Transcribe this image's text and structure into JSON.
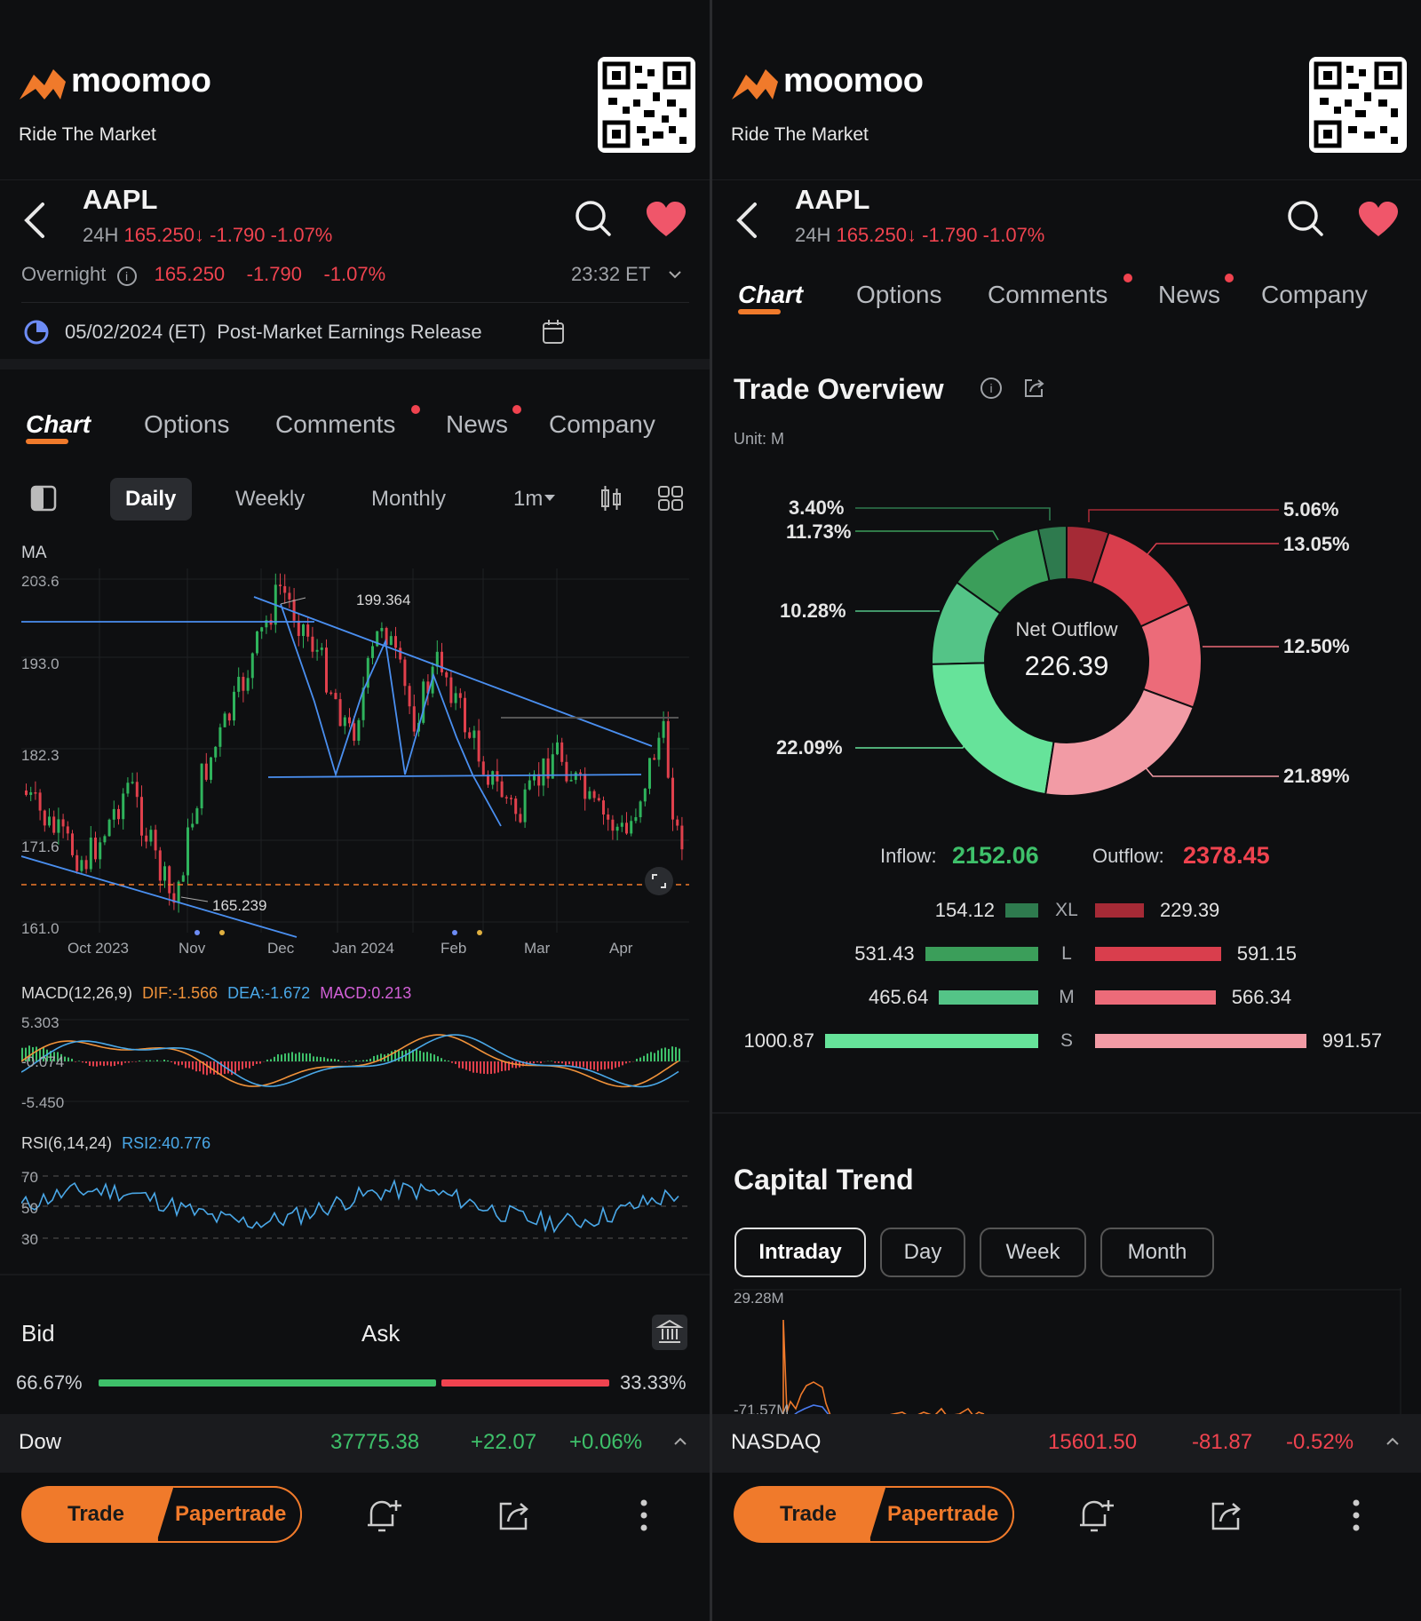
{
  "brand": {
    "name": "moomoo",
    "tagline": "Ride The Market"
  },
  "stock": {
    "symbol": "AAPL",
    "session": "24H",
    "price": "165.250",
    "change": "-1.790",
    "change_pct": "-1.07%",
    "overnight_label": "Overnight",
    "overnight_price": "165.250",
    "overnight_change": "-1.790",
    "overnight_pct": "-1.07%",
    "time": "23:32 ET",
    "earnings": "05/02/2024 (ET)  Post-Market Earnings Release"
  },
  "tabs": [
    "Chart",
    "Options",
    "Comments",
    "News",
    "Company"
  ],
  "period_tabs": [
    "Daily",
    "Weekly",
    "Monthly",
    "1m"
  ],
  "ma_label": "MA",
  "price_axis": [
    "203.6",
    "193.0",
    "182.3",
    "171.6",
    "161.0"
  ],
  "date_axis": [
    "Oct 2023",
    "Nov",
    "Dec",
    "Jan 2024",
    "Feb",
    "Mar",
    "Apr"
  ],
  "annotations": {
    "high": "199.364",
    "low": "165.239"
  },
  "macd": {
    "title": "MACD(12,26,9)",
    "dif": "DIF:-1.566",
    "dea": "DEA:-1.672",
    "macd": "MACD:0.213",
    "axis": [
      "5.303",
      "-0.074",
      "-5.450"
    ]
  },
  "rsi": {
    "title": "RSI(6,14,24)",
    "rsi2": "RSI2:40.776",
    "axis": [
      "70",
      "50",
      "30"
    ]
  },
  "bidask": {
    "bid": "Bid",
    "ask": "Ask",
    "bid_pct": "66.67%",
    "ask_pct": "33.33%",
    "bid_share": 66.67
  },
  "tickers": {
    "left": {
      "name": "Dow",
      "value": "37775.38",
      "change": "+22.07",
      "pct": "+0.06%"
    },
    "right": {
      "name": "NASDAQ",
      "value": "15601.50",
      "change": "-81.87",
      "pct": "-0.52%"
    }
  },
  "actions": {
    "trade": "Trade",
    "papertrade": "Papertrade"
  },
  "trade_overview": {
    "title": "Trade Overview",
    "unit": "Unit: M",
    "center_label": "Net Outflow",
    "center_value": "226.39",
    "inflow_label": "Inflow:",
    "inflow_value": "2152.06",
    "outflow_label": "Outflow:",
    "outflow_value": "2378.45",
    "pie_pcts": {
      "in_xl": "3.40%",
      "in_l": "11.73%",
      "in_m": "10.28%",
      "in_s": "22.09%",
      "out_xl": "5.06%",
      "out_l": "13.05%",
      "out_m": "12.50%",
      "out_s": "21.89%"
    },
    "rows": [
      {
        "size": "XL",
        "in": "154.12",
        "out": "229.39",
        "in_v": 154.12,
        "out_v": 229.39
      },
      {
        "size": "L",
        "in": "531.43",
        "out": "591.15",
        "in_v": 531.43,
        "out_v": 591.15
      },
      {
        "size": "M",
        "in": "465.64",
        "out": "566.34",
        "in_v": 465.64,
        "out_v": 566.34
      },
      {
        "size": "S",
        "in": "1000.87",
        "out": "991.57",
        "in_v": 1000.87,
        "out_v": 991.57
      }
    ]
  },
  "capital_trend": {
    "title": "Capital Trend",
    "tabs": [
      "Intraday",
      "Day",
      "Week",
      "Month"
    ],
    "ymax": "29.28M",
    "ymin": "-71.57M"
  },
  "chart_data": {
    "type": "pie",
    "title": "Trade Overview",
    "center_label": "Net Outflow",
    "center_value": 226.39,
    "unit": "M",
    "slices": [
      {
        "label": "Inflow XL",
        "pct": 3.4,
        "color": "#2e7a4e"
      },
      {
        "label": "Inflow L",
        "pct": 11.73,
        "color": "#3b9e5a"
      },
      {
        "label": "Inflow M",
        "pct": 10.28,
        "color": "#54c487"
      },
      {
        "label": "Inflow S",
        "pct": 22.09,
        "color": "#66e39a"
      },
      {
        "label": "Outflow S",
        "pct": 21.89,
        "color": "#f29ba5"
      },
      {
        "label": "Outflow M",
        "pct": 12.5,
        "color": "#ec6b79"
      },
      {
        "label": "Outflow L",
        "pct": 13.05,
        "color": "#d93e4d"
      },
      {
        "label": "Outflow XL",
        "pct": 5.06,
        "color": "#a52a36"
      }
    ]
  }
}
